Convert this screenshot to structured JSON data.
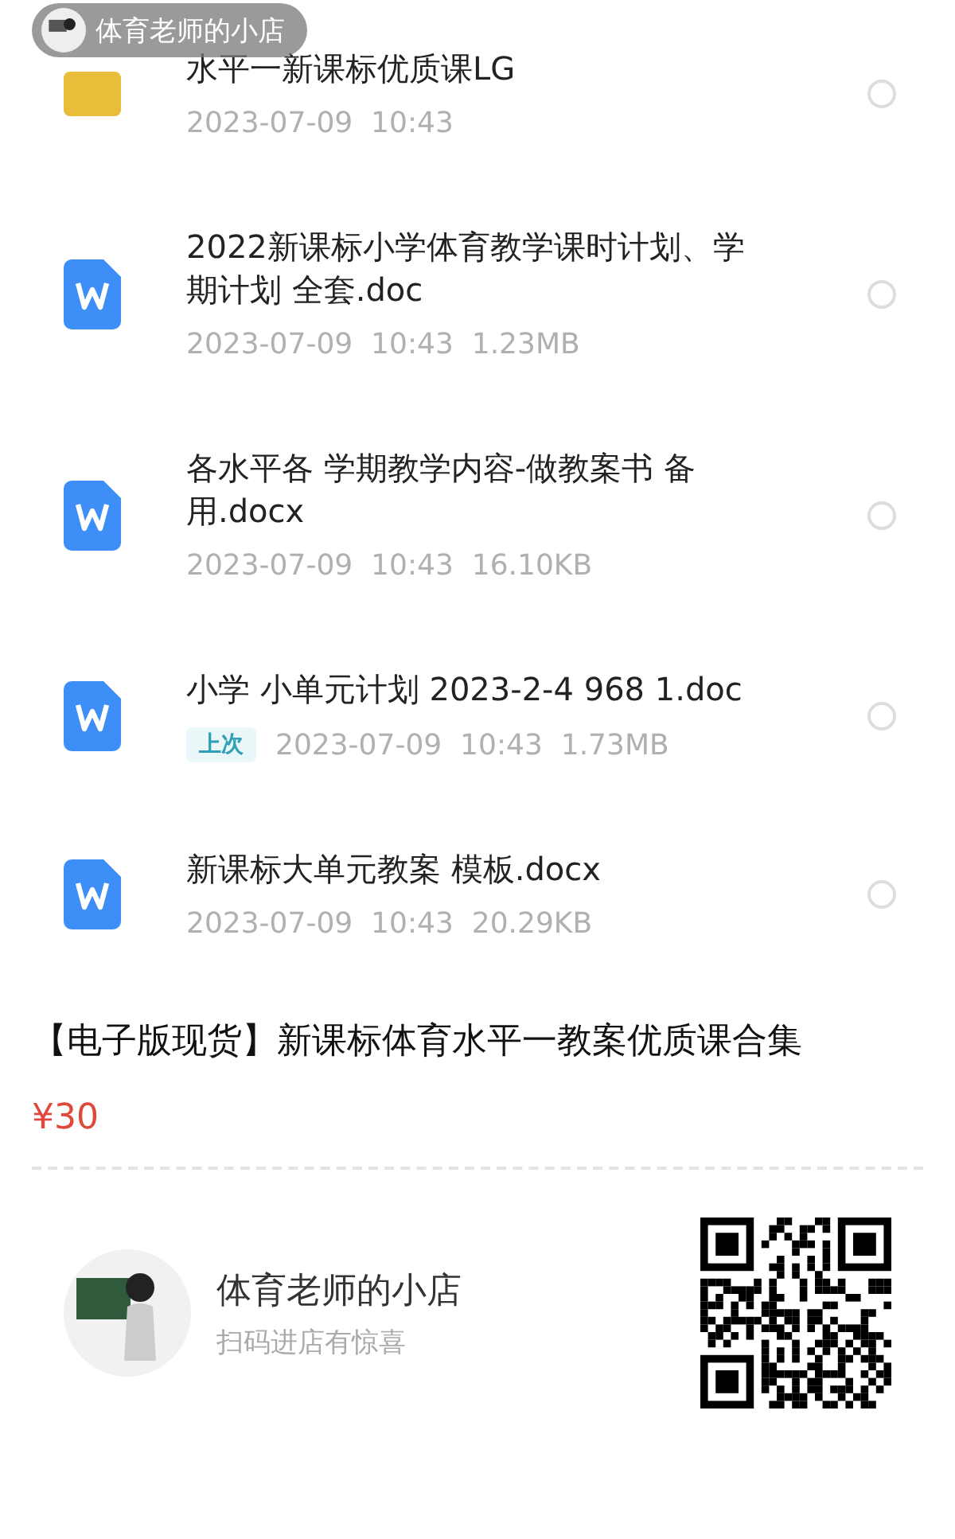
{
  "overlay_badge": {
    "label": "体育老师的小店"
  },
  "files": [
    {
      "kind": "folder",
      "name": "水平一新课标优质课LG",
      "date": "2023-07-09  10:43",
      "selected": false
    },
    {
      "kind": "word",
      "name": "2022新课标小学体育教学课时计划、学期计划  全套.doc",
      "date": "2023-07-09  10:43  1.23MB",
      "selected": false
    },
    {
      "kind": "word",
      "name": "各水平各  学期教学内容-做教案书 备用.docx",
      "date": "2023-07-09  10:43  16.10KB",
      "selected": false
    },
    {
      "kind": "word",
      "name": "小学 小单元计划 2023-2-4 968 1.doc",
      "tag": "上次",
      "date": "2023-07-09  10:43  1.73MB",
      "selected": false
    },
    {
      "kind": "word",
      "name": "新课标大单元教案  模板.docx",
      "date": "2023-07-09  10:43  20.29KB",
      "selected": false
    }
  ],
  "product": {
    "title": "【电子版现货】新课标体育水平一教案优质课合集",
    "price": "¥30"
  },
  "shop": {
    "name": "体育老师的小店",
    "subtitle": "扫码进店有惊喜"
  }
}
